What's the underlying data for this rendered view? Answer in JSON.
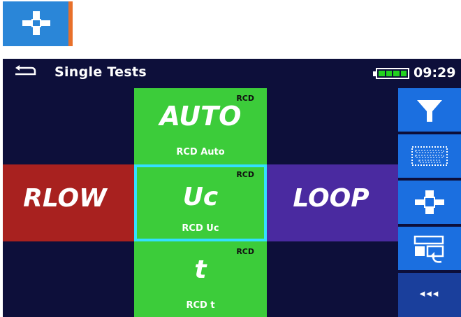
{
  "header": {
    "title": "Single Tests",
    "time": "09:29",
    "battery_level": 1.0,
    "back_icon": "back-arrow-icon"
  },
  "tiles": {
    "auto": {
      "name": "AUTO",
      "tag": "RCD",
      "label": "RCD Auto",
      "color": "#3ccc3a"
    },
    "rlow": {
      "name": "RLOW",
      "color": "#a8211f"
    },
    "uc": {
      "name": "Uc",
      "tag": "RCD",
      "label": "RCD Uc",
      "color": "#3ccc3a",
      "selected": true,
      "border": "#33e0ff"
    },
    "loop": {
      "name": "LOOP",
      "color": "#4a2aa0"
    },
    "t": {
      "name": "t",
      "tag": "RCD",
      "label": "RCD t",
      "color": "#3ccc3a"
    }
  },
  "sidebar": {
    "more_label": "◂◂◂",
    "icons": [
      "filter-icon",
      "keyboard-icon",
      "cross-view-icon",
      "switch-view-icon"
    ]
  },
  "colors": {
    "screen_bg": "#0d0f3a",
    "sidebar_button": "#1b6fe0",
    "corner_button": "#2a86d8",
    "corner_accent": "#e8702a"
  }
}
